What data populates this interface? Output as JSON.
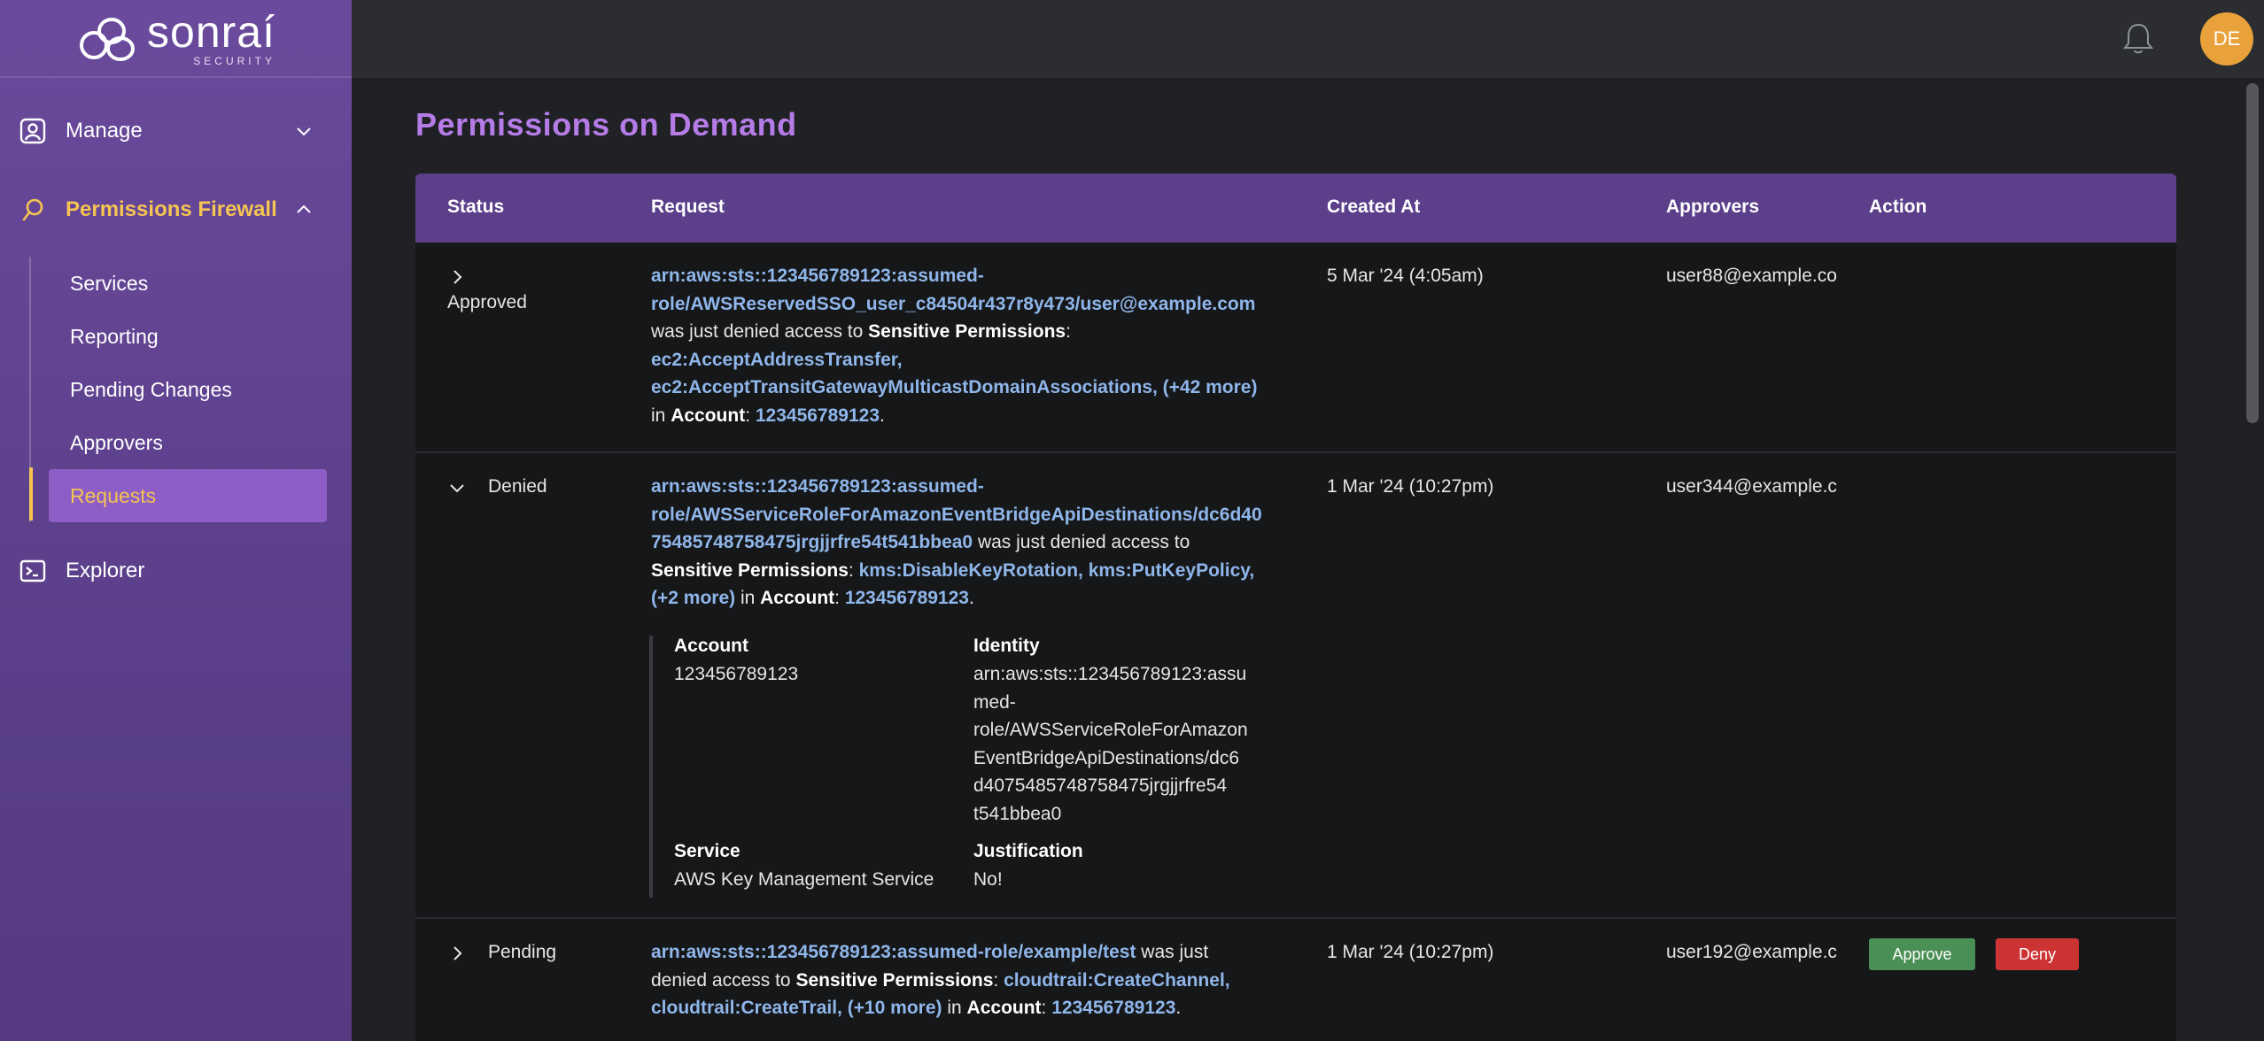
{
  "brand": {
    "name": "sonraí",
    "sub": "SECURITY"
  },
  "user": {
    "initials": "DE"
  },
  "sidebar": {
    "manage": "Manage",
    "permissions_firewall": "Permissions Firewall",
    "items": [
      {
        "label": "Services"
      },
      {
        "label": "Reporting"
      },
      {
        "label": "Pending Changes"
      },
      {
        "label": "Approvers"
      },
      {
        "label": "Requests"
      }
    ],
    "explorer": "Explorer"
  },
  "page": {
    "title": "Permissions on Demand"
  },
  "table": {
    "headers": {
      "status": "Status",
      "request": "Request",
      "created_at": "Created At",
      "approvers": "Approvers",
      "action": "Action"
    },
    "rows": [
      {
        "status": "Approved",
        "identity_l1": "arn:aws:sts::123456789123:assumed-",
        "identity_l2": "role/AWSReservedSSO_user_c84504r437r8y473/user@example.com",
        "mid1": "was just denied access to ",
        "sp_label": "Sensitive Permissions",
        "colon": ":",
        "perm1": "ec2:AcceptAddressTransfer,",
        "perm2": "ec2:AcceptTransitGatewayMulticastDomainAssociations, (+42 more)",
        "in_text": "in ",
        "acct_label": "Account",
        "acct_colon": ": ",
        "account": "123456789123",
        "period": ".",
        "created_at": "5 Mar '24 (4:05am)",
        "approvers": "user88@example.co"
      },
      {
        "status": "Denied",
        "identity_l1": "arn:aws:sts::123456789123:assumed-",
        "identity_l2": "role/AWSServiceRoleForAmazonEventBridgeApiDestinations/dc6d40",
        "identity_l3": "75485748758475jrgjjrfre54t541bbea0",
        "mid1": " was just denied access to",
        "sp_label": "Sensitive Permissions",
        "colon": ": ",
        "perm1": "kms:DisableKeyRotation, kms:PutKeyPolicy,",
        "perm2": "(+2 more)",
        "in_text": " in ",
        "acct_label": "Account",
        "acct_colon": ": ",
        "account": "123456789123",
        "period": ".",
        "created_at": "1 Mar '24 (10:27pm)",
        "approvers": "user344@example.c",
        "detail": {
          "account_label": "Account",
          "account_value": "123456789123",
          "identity_label": "Identity",
          "identity_lines": [
            "arn:aws:sts::123456789123:assu",
            "med-",
            "role/AWSServiceRoleForAmazon",
            "EventBridgeApiDestinations/dc6",
            "d4075485748758475jrgjjrfre54",
            "t541bbea0"
          ],
          "service_label": "Service",
          "service_value": "AWS Key Management Service",
          "justification_label": "Justification",
          "justification_value": "No!"
        }
      },
      {
        "status": "Pending",
        "identity_l1": "arn:aws:sts::123456789123:assumed-role/example/test",
        "mid1": " was just",
        "mid2": "denied access to ",
        "sp_label": "Sensitive Permissions",
        "colon": ": ",
        "perm1": "cloudtrail:CreateChannel,",
        "perm2": "cloudtrail:CreateTrail, (+10 more)",
        "in_text": " in ",
        "acct_label": "Account",
        "acct_colon": ": ",
        "account": "123456789123",
        "period": ".",
        "created_at": "1 Mar '24 (10:27pm)",
        "approvers": "user192@example.c",
        "approve_label": "Approve",
        "deny_label": "Deny"
      }
    ]
  },
  "colors": {
    "accent_purple": "#b57be6",
    "sidebar_purple": "#5b3f8a",
    "highlight_yellow": "#f5c451",
    "link_blue": "#8fb6ea",
    "approve_green": "#4a8f55",
    "deny_red": "#cc3333"
  },
  "icons": {
    "manage": "user-badge-icon",
    "firewall": "magnifier-icon",
    "explorer": "terminal-icon",
    "notifications": "bell-icon"
  }
}
